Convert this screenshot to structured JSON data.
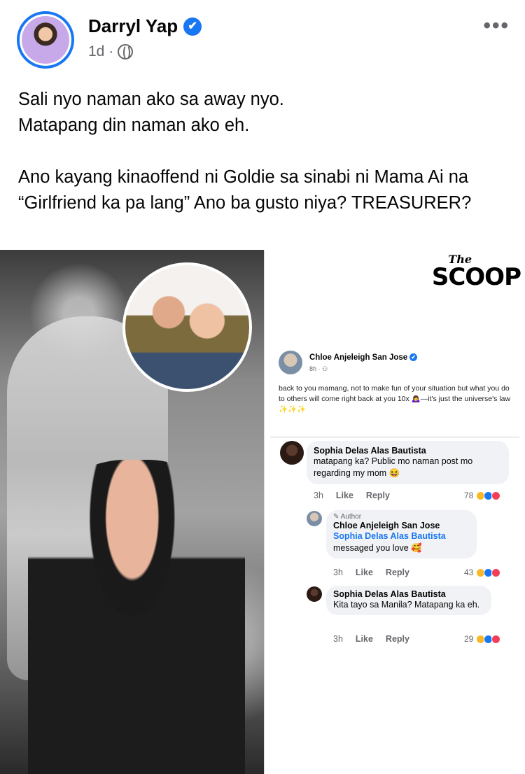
{
  "post": {
    "author": "Darryl Yap",
    "verified_glyph": "✔",
    "time": "1d ·",
    "privacy_icon": "globe-icon",
    "more_glyph": "•••",
    "caption": [
      "Sali nyo naman ako sa away nyo.",
      "Matapang din naman ako eh.",
      "",
      "Ano kayang kinaoffend ni Goldie sa sinabi ni Mama Ai na “Girlfriend ka pa lang” Ano ba gusto niya? TREASURER?"
    ]
  },
  "image": {
    "brand_the": "The",
    "brand_scoop": "SCOOP",
    "original_post": {
      "author": "Chloe Anjeleigh San Jose",
      "time": "8h · ⚇",
      "text": "back to you mamang, not to make fun of your situation but what you do to others will come right back at you 10x 🙇‍♀️—it's just the universe's law ✨✨✨"
    },
    "comments": [
      {
        "author": "Sophia Delas Alas Bautista",
        "text": "matapang ka? Public mo naman post mo regarding my mom 😆",
        "time": "3h",
        "like": "Like",
        "reply": "Reply",
        "reactions": "78"
      },
      {
        "author_tag": "✎ Author",
        "author": "Chloe Anjeleigh San Jose",
        "mention": "Sophia Delas Alas Bautista",
        "text": "messaged you love 🥰",
        "time": "3h",
        "like": "Like",
        "reply": "Reply",
        "reactions": "43"
      },
      {
        "author": "Sophia Delas Alas Bautista",
        "text": "Kita tayo sa Manila? Matapang ka eh.",
        "time": "3h",
        "like": "Like",
        "reply": "Reply",
        "reactions": "29"
      }
    ]
  },
  "colors": {
    "accent": "#1877f2",
    "secondary_text": "#65676b",
    "bubble": "#f0f2f5"
  }
}
